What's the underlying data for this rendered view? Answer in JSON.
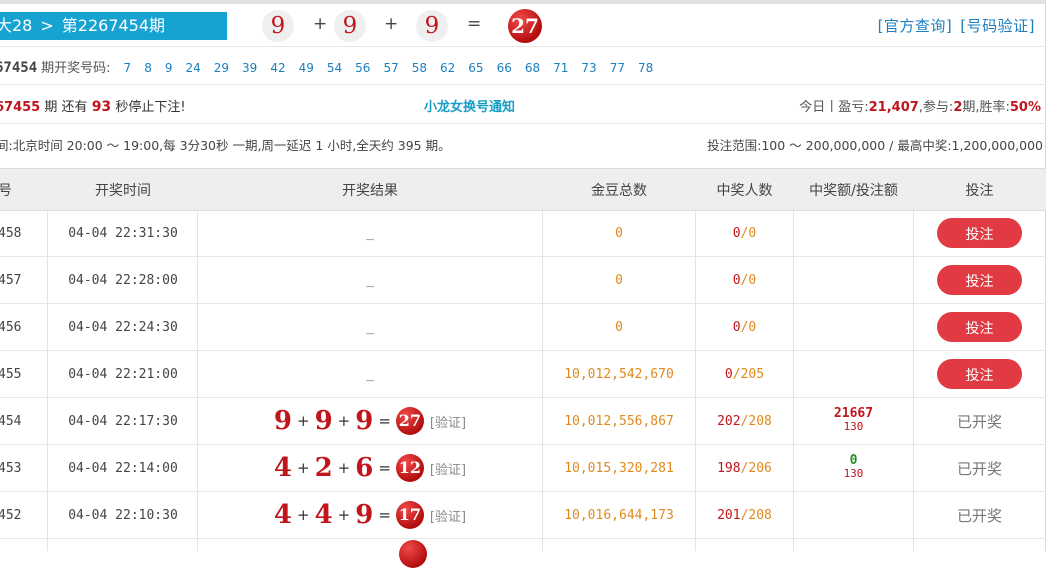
{
  "header": {
    "breadcrumb_prefix": "大28",
    "breadcrumb_sep": ">",
    "breadcrumb_period": "第2267454期",
    "balls": [
      "9",
      "9",
      "9"
    ],
    "plus": "+",
    "equals": "=",
    "sum": "27",
    "link_official": "[官方查询]",
    "link_verify": "[号码验证]"
  },
  "numbers_row": {
    "period": "67454",
    "label": "期开奖号码:",
    "numbers": [
      "7",
      "8",
      "9",
      "24",
      "29",
      "39",
      "42",
      "49",
      "54",
      "56",
      "57",
      "58",
      "62",
      "65",
      "66",
      "68",
      "71",
      "73",
      "77",
      "78"
    ]
  },
  "countdown": {
    "period": "67455",
    "label_period": "期",
    "label_still": "还有",
    "seconds": "93",
    "label_stop": "秒停止下注!",
    "notice": "小龙女换号通知",
    "today_label": "今日丨盈亏:",
    "profit": "21,407",
    "join_label": ",参与:",
    "join_count": "2",
    "join_unit": "期,胜率:",
    "win_rate": "50%"
  },
  "info": {
    "schedule": "间:北京时间 20:00 ～ 19:00,每 3分30秒 一期,周一延迟 1 小时,全天约 395 期。",
    "range": "投注范围:100 ～ 200,000,000 / 最高中奖:1,200,000,000"
  },
  "table": {
    "headers": [
      "号",
      "开奖时间",
      "开奖结果",
      "金豆总数",
      "中奖人数",
      "中奖额/投注额",
      "投注"
    ],
    "rows": [
      {
        "id": "458",
        "time": "04-04 22:31:30",
        "result": "_",
        "coins": "0",
        "win_a": "0",
        "win_b": "0",
        "action": "投注"
      },
      {
        "id": "457",
        "time": "04-04 22:28:00",
        "result": "_",
        "coins": "0",
        "win_a": "0",
        "win_b": "0",
        "action": "投注"
      },
      {
        "id": "456",
        "time": "04-04 22:24:30",
        "result": "_",
        "coins": "0",
        "win_a": "0",
        "win_b": "0",
        "action": "投注"
      },
      {
        "id": "455",
        "time": "04-04 22:21:00",
        "result": "_",
        "coins": "10,012,542,670",
        "win_a": "0",
        "win_b": "205",
        "action": "投注"
      },
      {
        "id": "454",
        "time": "04-04 22:17:30",
        "n1": "9",
        "n2": "9",
        "n3": "9",
        "sum": "27",
        "verify": "[验证]",
        "coins": "10,012,556,867",
        "win_a": "202",
        "win_b": "208",
        "ratio_top": "21667",
        "ratio_bot": "130",
        "status": "已开奖"
      },
      {
        "id": "453",
        "time": "04-04 22:14:00",
        "n1": "4",
        "n2": "2",
        "n3": "6",
        "sum": "12",
        "verify": "[验证]",
        "coins": "10,015,320,281",
        "win_a": "198",
        "win_b": "206",
        "ratio_top": "0",
        "ratio_bot": "130",
        "status": "已开奖"
      },
      {
        "id": "452",
        "time": "04-04 22:10:30",
        "n1": "4",
        "n2": "4",
        "n3": "9",
        "sum": "17",
        "verify": "[验证]",
        "coins": "10,016,644,173",
        "win_a": "201",
        "win_b": "208",
        "status": "已开奖"
      }
    ]
  },
  "colors": {
    "accent": "#17a3d2",
    "red": "#c0161b",
    "button": "#e23a43",
    "orange": "#e08a1e",
    "link": "#1b7fc0",
    "green": "#1f8f1f"
  }
}
